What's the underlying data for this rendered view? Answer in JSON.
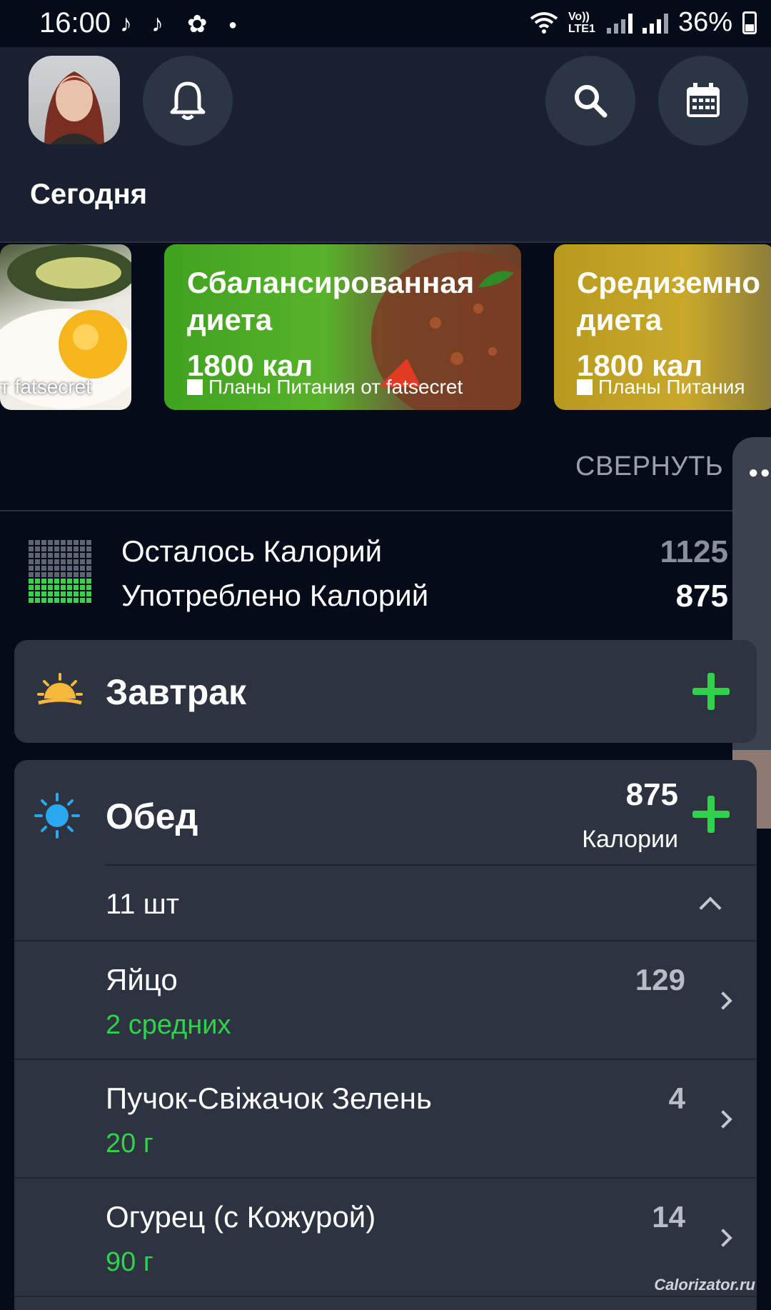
{
  "status_bar": {
    "time": "16:00",
    "network": "Vo)) LTE1",
    "battery": "36%",
    "icons": [
      "tiktok-icon",
      "tiktok-icon",
      "cat-icon",
      "dot-icon",
      "wifi-icon",
      "signal-icon",
      "signal-icon",
      "battery-icon"
    ]
  },
  "header": {
    "title": "Сегодня",
    "buttons": [
      "avatar",
      "notifications-bell-icon",
      "search-icon",
      "calendar-icon"
    ]
  },
  "carousel": {
    "cards": [
      {
        "title": "",
        "subtitle": "т fatsecret",
        "image": "avocado-egg"
      },
      {
        "title_line1": "Сбалансированная",
        "title_line2": "диета",
        "kcal": "1800 кал",
        "subtitle": "Планы Питания от fatsecret",
        "image": "ground-meat"
      },
      {
        "title_line1": "Средиземно",
        "title_line2": "диета",
        "kcal": "1800 кал",
        "subtitle": "Планы Питания",
        "image": "salad"
      }
    ],
    "collapse_label": "СВЕРНУТЬ"
  },
  "summary": {
    "remaining_label": "Осталось Калорий",
    "remaining_value": "1125",
    "consumed_label": "Употреблено Калорий",
    "consumed_value": "875",
    "progress_fraction": 0.4375
  },
  "meals": {
    "breakfast": {
      "title": "Завтрак"
    },
    "lunch": {
      "title": "Обед",
      "calories": "875",
      "calories_label": "Калории",
      "count": "11 шт",
      "items": [
        {
          "name": "Яйцо",
          "qty": "2 средних",
          "cal": "129"
        },
        {
          "name": "Пучок-Свіжачок Зелень",
          "qty": "20 г",
          "cal": "4"
        },
        {
          "name": "Огурец (с Кожурой)",
          "qty": "90 г",
          "cal": "14"
        }
      ]
    }
  },
  "watermark": "Calorizator.ru",
  "colors": {
    "accent_green": "#2fd24b",
    "background": "#060b1a",
    "card": "#2e3341"
  }
}
